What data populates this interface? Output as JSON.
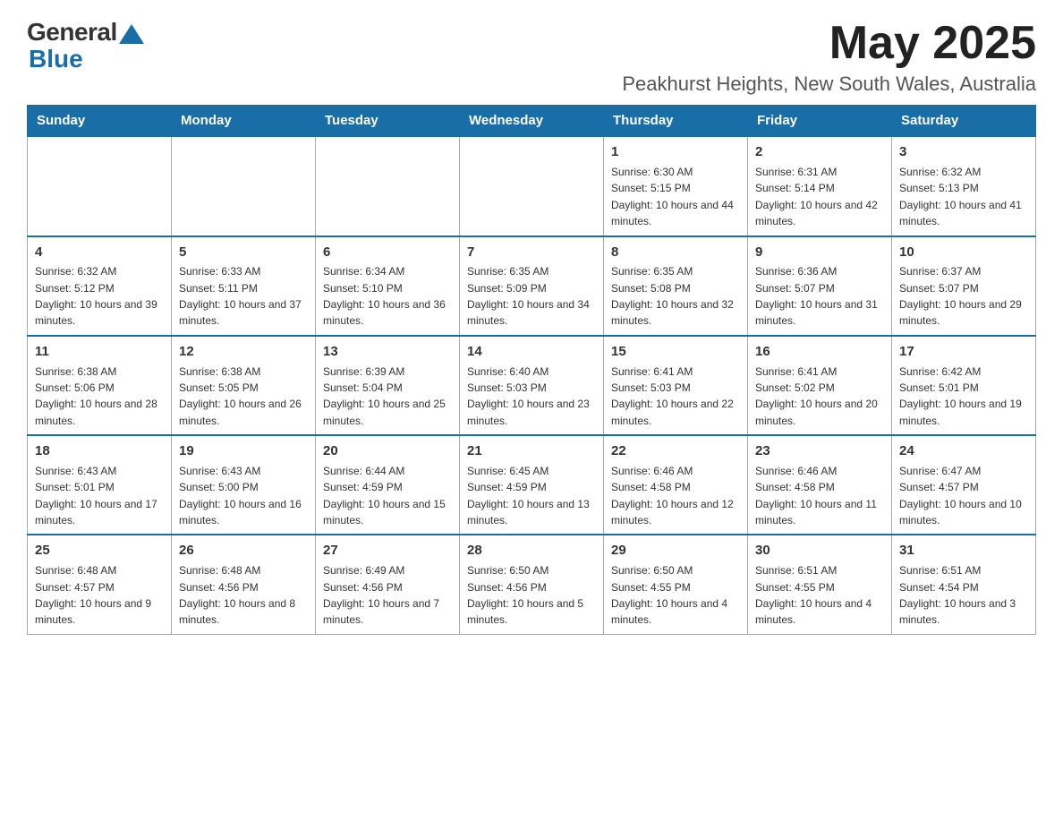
{
  "logo": {
    "general": "General",
    "blue": "Blue"
  },
  "header": {
    "month_year": "May 2025",
    "location": "Peakhurst Heights, New South Wales, Australia"
  },
  "weekdays": [
    "Sunday",
    "Monday",
    "Tuesday",
    "Wednesday",
    "Thursday",
    "Friday",
    "Saturday"
  ],
  "weeks": [
    [
      {
        "day": "",
        "info": ""
      },
      {
        "day": "",
        "info": ""
      },
      {
        "day": "",
        "info": ""
      },
      {
        "day": "",
        "info": ""
      },
      {
        "day": "1",
        "info": "Sunrise: 6:30 AM\nSunset: 5:15 PM\nDaylight: 10 hours and 44 minutes."
      },
      {
        "day": "2",
        "info": "Sunrise: 6:31 AM\nSunset: 5:14 PM\nDaylight: 10 hours and 42 minutes."
      },
      {
        "day": "3",
        "info": "Sunrise: 6:32 AM\nSunset: 5:13 PM\nDaylight: 10 hours and 41 minutes."
      }
    ],
    [
      {
        "day": "4",
        "info": "Sunrise: 6:32 AM\nSunset: 5:12 PM\nDaylight: 10 hours and 39 minutes."
      },
      {
        "day": "5",
        "info": "Sunrise: 6:33 AM\nSunset: 5:11 PM\nDaylight: 10 hours and 37 minutes."
      },
      {
        "day": "6",
        "info": "Sunrise: 6:34 AM\nSunset: 5:10 PM\nDaylight: 10 hours and 36 minutes."
      },
      {
        "day": "7",
        "info": "Sunrise: 6:35 AM\nSunset: 5:09 PM\nDaylight: 10 hours and 34 minutes."
      },
      {
        "day": "8",
        "info": "Sunrise: 6:35 AM\nSunset: 5:08 PM\nDaylight: 10 hours and 32 minutes."
      },
      {
        "day": "9",
        "info": "Sunrise: 6:36 AM\nSunset: 5:07 PM\nDaylight: 10 hours and 31 minutes."
      },
      {
        "day": "10",
        "info": "Sunrise: 6:37 AM\nSunset: 5:07 PM\nDaylight: 10 hours and 29 minutes."
      }
    ],
    [
      {
        "day": "11",
        "info": "Sunrise: 6:38 AM\nSunset: 5:06 PM\nDaylight: 10 hours and 28 minutes."
      },
      {
        "day": "12",
        "info": "Sunrise: 6:38 AM\nSunset: 5:05 PM\nDaylight: 10 hours and 26 minutes."
      },
      {
        "day": "13",
        "info": "Sunrise: 6:39 AM\nSunset: 5:04 PM\nDaylight: 10 hours and 25 minutes."
      },
      {
        "day": "14",
        "info": "Sunrise: 6:40 AM\nSunset: 5:03 PM\nDaylight: 10 hours and 23 minutes."
      },
      {
        "day": "15",
        "info": "Sunrise: 6:41 AM\nSunset: 5:03 PM\nDaylight: 10 hours and 22 minutes."
      },
      {
        "day": "16",
        "info": "Sunrise: 6:41 AM\nSunset: 5:02 PM\nDaylight: 10 hours and 20 minutes."
      },
      {
        "day": "17",
        "info": "Sunrise: 6:42 AM\nSunset: 5:01 PM\nDaylight: 10 hours and 19 minutes."
      }
    ],
    [
      {
        "day": "18",
        "info": "Sunrise: 6:43 AM\nSunset: 5:01 PM\nDaylight: 10 hours and 17 minutes."
      },
      {
        "day": "19",
        "info": "Sunrise: 6:43 AM\nSunset: 5:00 PM\nDaylight: 10 hours and 16 minutes."
      },
      {
        "day": "20",
        "info": "Sunrise: 6:44 AM\nSunset: 4:59 PM\nDaylight: 10 hours and 15 minutes."
      },
      {
        "day": "21",
        "info": "Sunrise: 6:45 AM\nSunset: 4:59 PM\nDaylight: 10 hours and 13 minutes."
      },
      {
        "day": "22",
        "info": "Sunrise: 6:46 AM\nSunset: 4:58 PM\nDaylight: 10 hours and 12 minutes."
      },
      {
        "day": "23",
        "info": "Sunrise: 6:46 AM\nSunset: 4:58 PM\nDaylight: 10 hours and 11 minutes."
      },
      {
        "day": "24",
        "info": "Sunrise: 6:47 AM\nSunset: 4:57 PM\nDaylight: 10 hours and 10 minutes."
      }
    ],
    [
      {
        "day": "25",
        "info": "Sunrise: 6:48 AM\nSunset: 4:57 PM\nDaylight: 10 hours and 9 minutes."
      },
      {
        "day": "26",
        "info": "Sunrise: 6:48 AM\nSunset: 4:56 PM\nDaylight: 10 hours and 8 minutes."
      },
      {
        "day": "27",
        "info": "Sunrise: 6:49 AM\nSunset: 4:56 PM\nDaylight: 10 hours and 7 minutes."
      },
      {
        "day": "28",
        "info": "Sunrise: 6:50 AM\nSunset: 4:56 PM\nDaylight: 10 hours and 5 minutes."
      },
      {
        "day": "29",
        "info": "Sunrise: 6:50 AM\nSunset: 4:55 PM\nDaylight: 10 hours and 4 minutes."
      },
      {
        "day": "30",
        "info": "Sunrise: 6:51 AM\nSunset: 4:55 PM\nDaylight: 10 hours and 4 minutes."
      },
      {
        "day": "31",
        "info": "Sunrise: 6:51 AM\nSunset: 4:54 PM\nDaylight: 10 hours and 3 minutes."
      }
    ]
  ]
}
